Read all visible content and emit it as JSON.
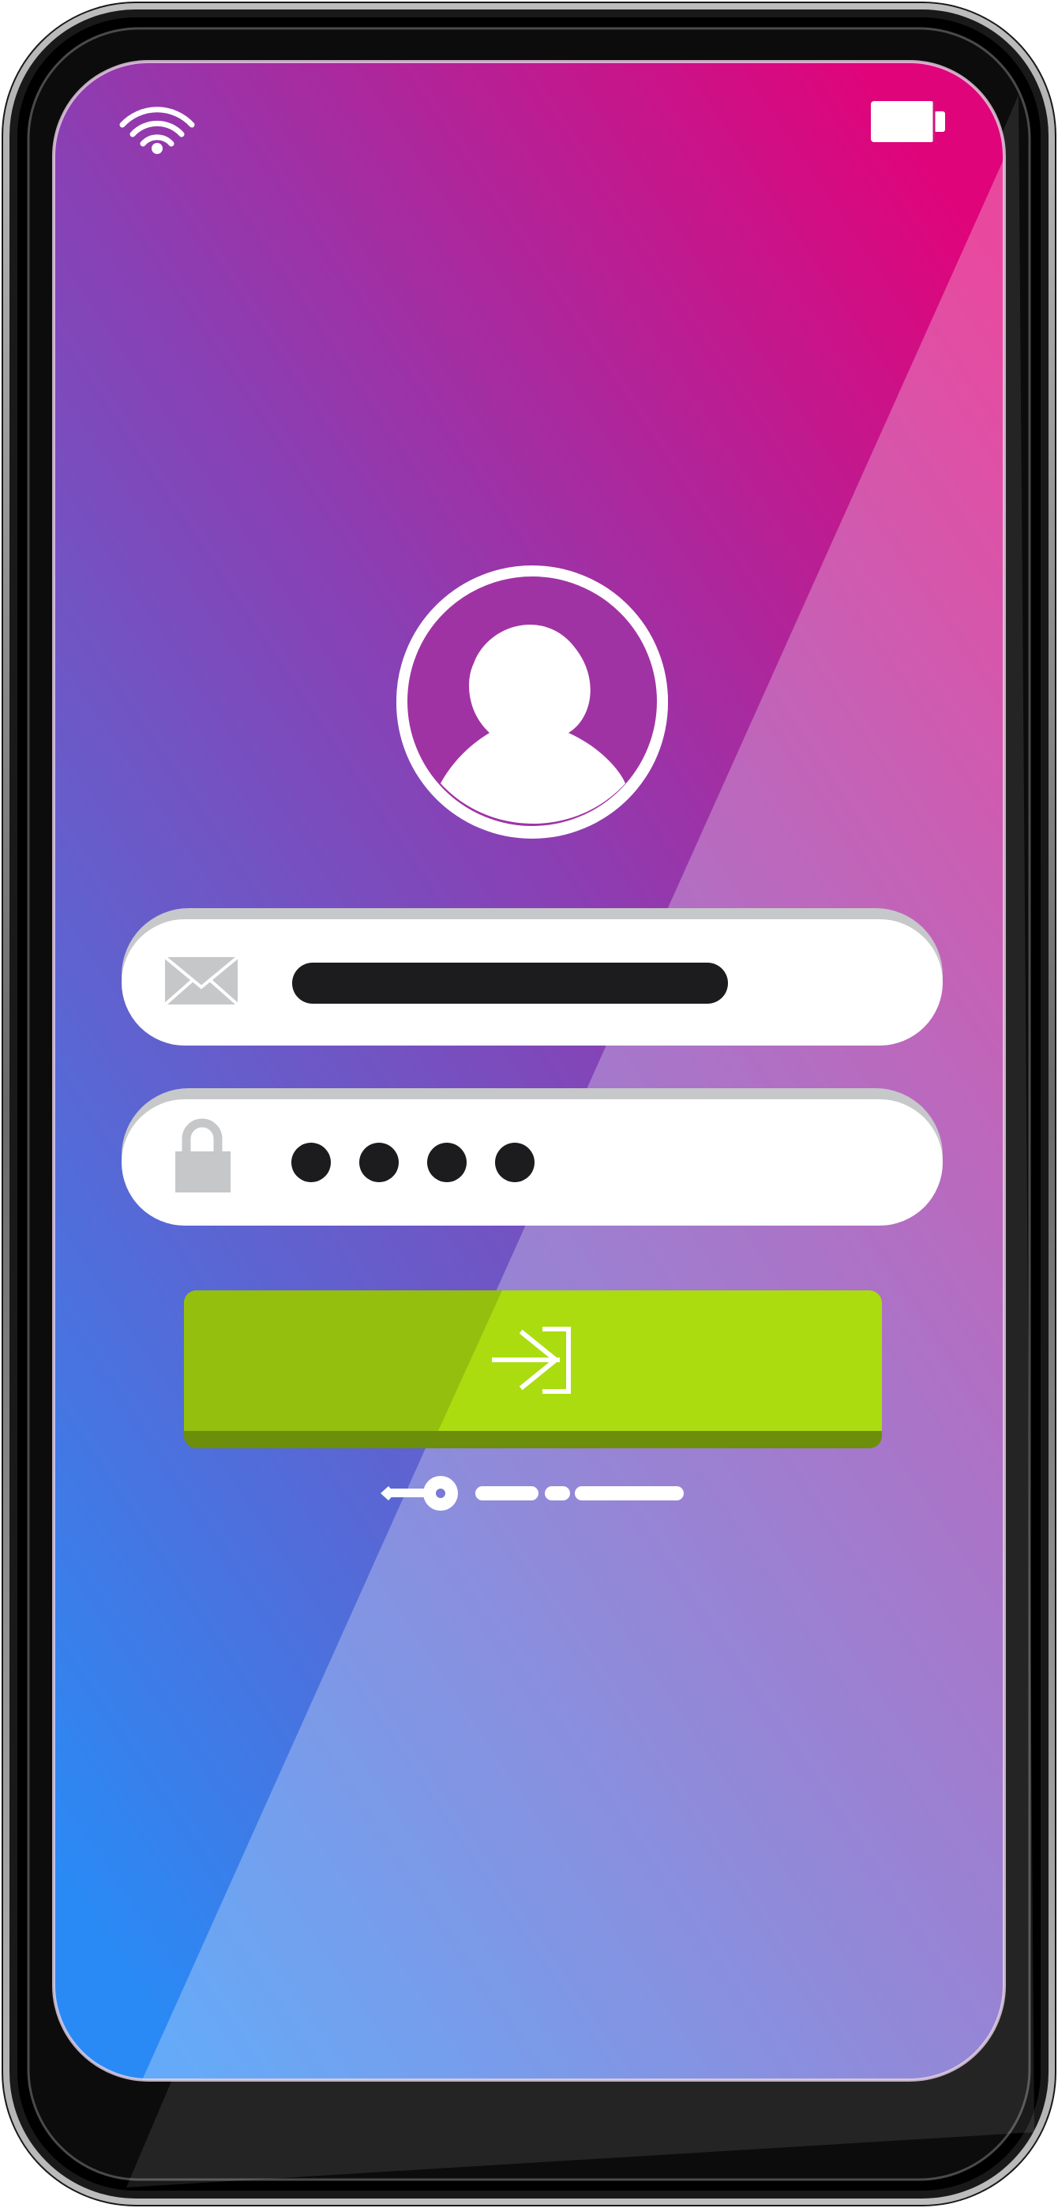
{
  "status_bar": {
    "wifi_icon": "wifi-icon",
    "battery_icon": "battery-icon",
    "battery_level": 1.0
  },
  "login": {
    "avatar_icon": "user-avatar-icon",
    "email_field": {
      "icon": "envelope-icon",
      "value_masked": true
    },
    "password_field": {
      "icon": "lock-icon",
      "masked_dot_count": 4
    },
    "login_button": {
      "icon": "sign-in-arrow-icon"
    },
    "forgot_password": {
      "icon": "key-icon"
    }
  },
  "colors": {
    "gradient_top": "#e0047a",
    "gradient_mid": "#8a3fb3",
    "gradient_bottom": "#2a8af5",
    "button_green": "#aadc10",
    "button_green_dark": "#95bf0e",
    "button_shadow": "#6c8e0a",
    "field_fill": "#ffffff",
    "field_shadow": "#c7c8ca",
    "icon_gray": "#c6c7c9",
    "dark_text": "#1c1c1e",
    "phone_frame": "#2a2929"
  }
}
